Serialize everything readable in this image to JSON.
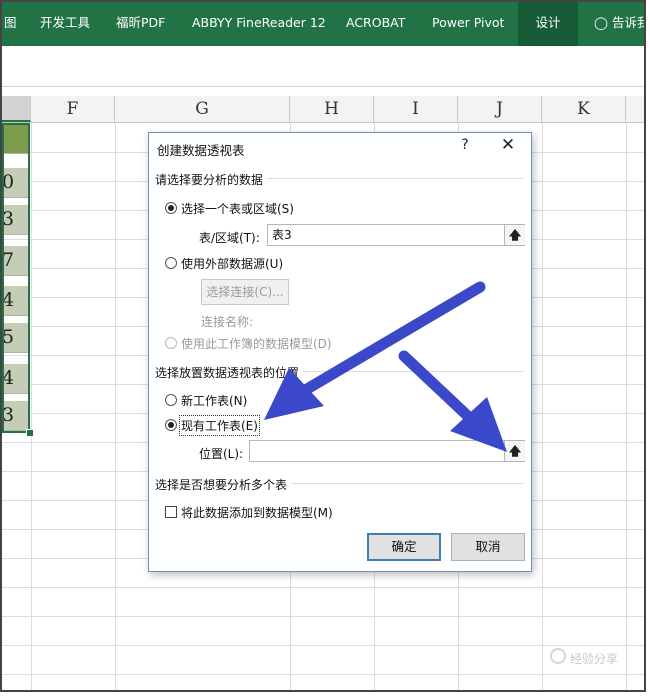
{
  "ribbon": {
    "tabs": [
      {
        "label": "图"
      },
      {
        "label": "开发工具"
      },
      {
        "label": "福昕PDF"
      },
      {
        "label": "ABBYY FineReader 12"
      },
      {
        "label": "ACROBAT"
      },
      {
        "label": "Power Pivot"
      },
      {
        "label": "设计"
      },
      {
        "label": "告诉我"
      }
    ]
  },
  "columns": [
    "F",
    "G",
    "H",
    "I",
    "J",
    "K"
  ],
  "cells": [
    "0",
    "3",
    "7",
    "4",
    "5",
    "4",
    "3"
  ],
  "dialog": {
    "title": "创建数据透视表",
    "help": "?",
    "close": "✕",
    "section1": "请选择要分析的数据",
    "opt_table": "选择一个表或区域(S)",
    "table_range_label": "表/区域(T):",
    "table_range_value": "表3",
    "opt_external": "使用外部数据源(U)",
    "choose_connection": "选择连接(C)...",
    "connection_name": "连接名称:",
    "opt_datamodel": "使用此工作簿的数据模型(D)",
    "section2": "选择放置数据透视表的位置",
    "opt_new_sheet": "新工作表(N)",
    "opt_existing_sheet": "现有工作表(E)",
    "location_label": "位置(L):",
    "location_value": "",
    "section3": "选择是否想要分析多个表",
    "add_to_model": "将此数据添加到数据模型(M)",
    "ok": "确定",
    "cancel": "取消"
  },
  "watermark": "经验分享",
  "colors": {
    "accent": "#217346",
    "arrow": "#3b48c9"
  }
}
